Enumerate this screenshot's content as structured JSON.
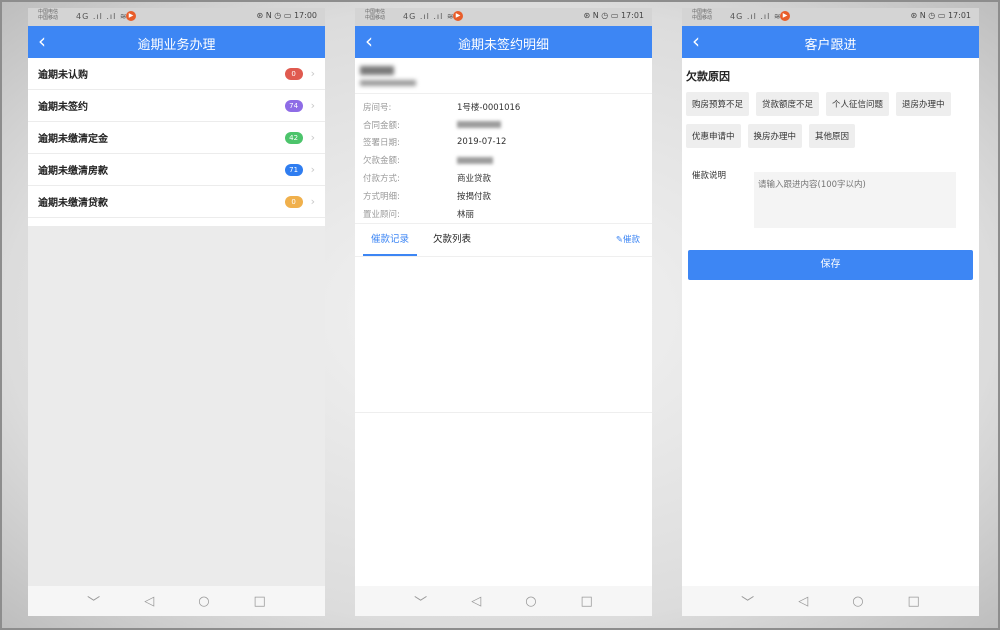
{
  "status": {
    "carrier_line1": "中国电信",
    "carrier_line2": "中国移动",
    "signal": "4G .ıl .ıl ≋",
    "icons": "⊛ N ◷ ▭",
    "time1": "17:00",
    "time2": "17:01",
    "time3": "17:01"
  },
  "phone1": {
    "title": "逾期业务办理",
    "rows": [
      {
        "label": "逾期未认购",
        "count": "0",
        "color": "#e05a4f"
      },
      {
        "label": "逾期未签约",
        "count": "74",
        "color": "#8e6ce6"
      },
      {
        "label": "逾期未缴清定金",
        "count": "42",
        "color": "#4cc46b"
      },
      {
        "label": "逾期未缴清房款",
        "count": "71",
        "color": "#2f7df0"
      },
      {
        "label": "逾期未缴清贷款",
        "count": "0",
        "color": "#f0b04c"
      }
    ]
  },
  "phone2": {
    "title": "逾期未签约明细",
    "details": [
      {
        "k": "房间号:",
        "v": "1号楼-0001016"
      },
      {
        "k": "合同金额:",
        "v": ""
      },
      {
        "k": "签署日期:",
        "v": "2019-07-12"
      },
      {
        "k": "欠款金额:",
        "v": ""
      },
      {
        "k": "付款方式:",
        "v": "商业贷款"
      },
      {
        "k": "方式明细:",
        "v": "按揭付款"
      },
      {
        "k": "置业顾问:",
        "v": "林丽"
      }
    ],
    "tabs": [
      "催款记录",
      "欠款列表"
    ],
    "action": "催款"
  },
  "phone3": {
    "title": "客户跟进",
    "section_title": "欠款原因",
    "reasons": [
      "购房预算不足",
      "贷款额度不足",
      "个人征信问题",
      "退房办理中",
      "优惠申请中",
      "换房办理中",
      "其他原因"
    ],
    "note_label": "催款说明",
    "note_placeholder": "请输入跟进内容(100字以内)",
    "save": "保存"
  },
  "system_nav": [
    "﹀",
    "◁",
    "○",
    "□"
  ],
  "back_glyph": "‹"
}
